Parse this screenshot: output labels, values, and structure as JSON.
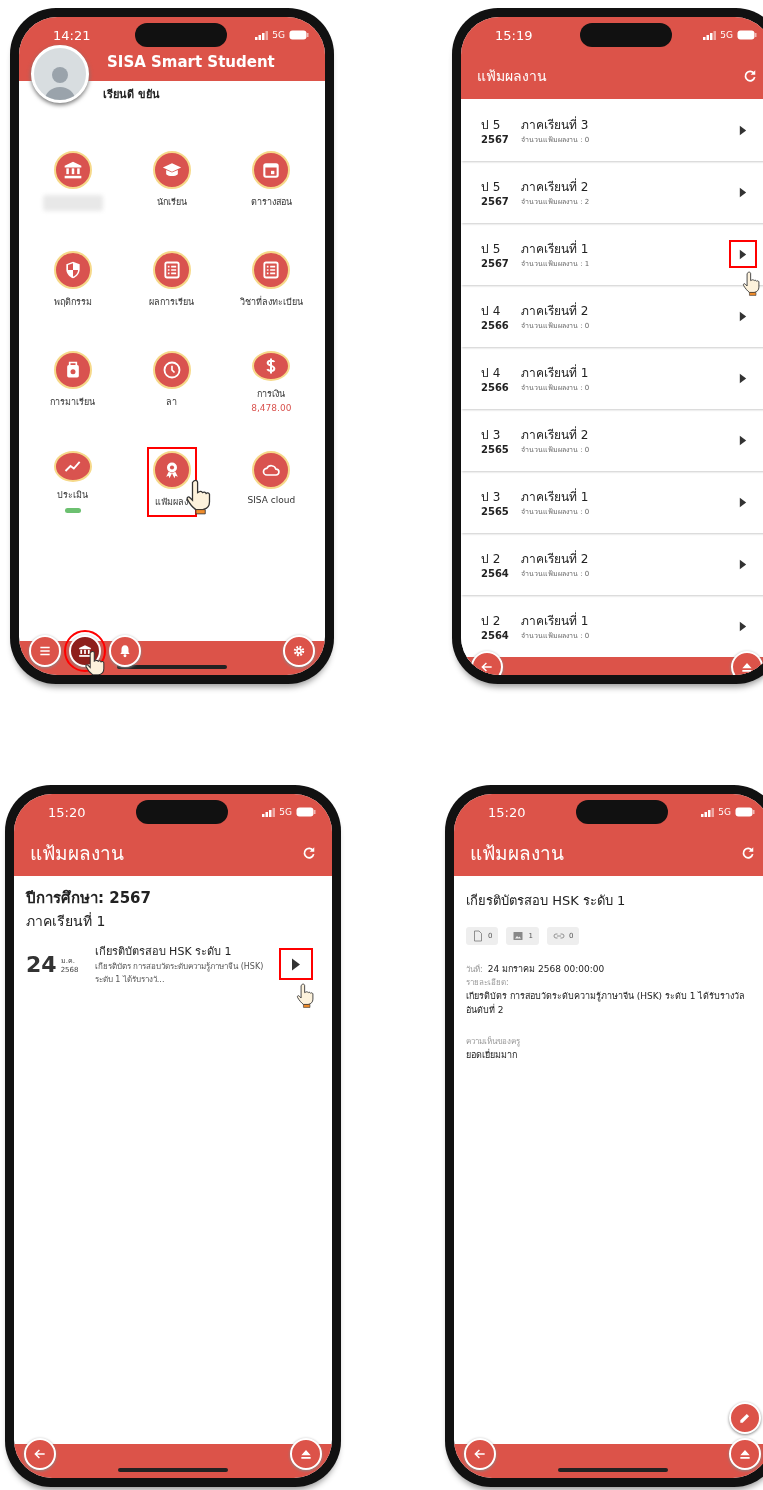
{
  "phones": [
    {
      "kind": "menu",
      "status": {
        "time": "14:21",
        "network": "5G"
      },
      "app_title": "SISA Smart Student",
      "user_name": "เรียนดี ขยัน",
      "tiles": [
        {
          "kind": "bank",
          "highlighted": false
        },
        {
          "kind": "graduation",
          "label": "นักเรียน",
          "highlighted": false
        },
        {
          "kind": "calendar",
          "label": "ตารางสอน",
          "highlighted": false
        },
        {
          "kind": "shield",
          "label": "พฤติกรรม",
          "highlighted": false
        },
        {
          "kind": "list",
          "label": "ผลการเรียน",
          "highlighted": false
        },
        {
          "kind": "list",
          "label": "วิชาที่ลงทะเบียน",
          "highlighted": false
        },
        {
          "kind": "bag",
          "label": "การมาเรียน",
          "highlighted": false
        },
        {
          "kind": "clock",
          "label": "ลา",
          "highlighted": false
        },
        {
          "kind": "dollar",
          "label": "การเงิน",
          "sub": "8,478.00",
          "highlighted": false
        },
        {
          "kind": "chart",
          "label": "ประเมิน",
          "pill": true,
          "highlighted": false
        },
        {
          "kind": "award",
          "label": "แฟ้มผลง",
          "highlighted": true
        },
        {
          "kind": "cloud",
          "label": "SISA cloud",
          "highlighted": false
        }
      ],
      "nav": [
        {
          "kind": "menu",
          "selected": false
        },
        {
          "kind": "bank",
          "selected": true
        },
        {
          "kind": "bell",
          "selected": false
        },
        {
          "kind": "gear",
          "selected": false
        }
      ]
    },
    {
      "kind": "semesters",
      "status": {
        "time": "15:19",
        "network": "5G"
      },
      "title": "แฟ้มผลงาน",
      "rows": [
        {
          "grade": "ป 5",
          "year": "2567",
          "term": "ภาคเรียนที่ 3",
          "count": "จำนวนแฟ้มผลงาน : 0",
          "highlighted": false
        },
        {
          "grade": "ป 5",
          "year": "2567",
          "term": "ภาคเรียนที่ 2",
          "count": "จำนวนแฟ้มผลงาน : 2",
          "highlighted": false
        },
        {
          "grade": "ป 5",
          "year": "2567",
          "term": "ภาคเรียนที่ 1",
          "count": "จำนวนแฟ้มผลงาน : 1",
          "highlighted": true
        },
        {
          "grade": "ป 4",
          "year": "2566",
          "term": "ภาคเรียนที่ 2",
          "count": "จำนวนแฟ้มผลงาน : 0",
          "highlighted": false
        },
        {
          "grade": "ป 4",
          "year": "2566",
          "term": "ภาคเรียนที่ 1",
          "count": "จำนวนแฟ้มผลงาน : 0",
          "highlighted": false
        },
        {
          "grade": "ป 3",
          "year": "2565",
          "term": "ภาคเรียนที่ 2",
          "count": "จำนวนแฟ้มผลงาน : 0",
          "highlighted": false
        },
        {
          "grade": "ป 3",
          "year": "2565",
          "term": "ภาคเรียนที่ 1",
          "count": "จำนวนแฟ้มผลงาน : 0",
          "highlighted": false
        },
        {
          "grade": "ป 2",
          "year": "2564",
          "term": "ภาคเรียนที่ 2",
          "count": "จำนวนแฟ้มผลงาน : 0",
          "highlighted": false
        },
        {
          "grade": "ป 2",
          "year": "2564",
          "term": "ภาคเรียนที่ 1",
          "count": "จำนวนแฟ้มผลงาน : 0",
          "highlighted": false
        }
      ]
    },
    {
      "kind": "portfolio",
      "status": {
        "time": "15:20",
        "network": "5G"
      },
      "title": "แฟ้มผลงาน",
      "year_heading": "ปีการศึกษา: 2567",
      "term": "ภาคเรียนที่ 1",
      "items": [
        {
          "day": "24",
          "month": "ม.ค.",
          "year": "2568",
          "title": "เกียรติบัตรสอบ HSK ระดับ 1",
          "summary": "เกียรติบัตร การสอบวัดระดับความรู้ภาษาจีน (HSK) ระดับ 1 ได้รับรางวั...",
          "highlighted": true
        }
      ]
    },
    {
      "kind": "detail",
      "status": {
        "time": "15:20",
        "network": "5G"
      },
      "title": "แฟ้มผลงาน",
      "item_title": "เกียรติบัตรสอบ HSK ระดับ 1",
      "counters": [
        {
          "kind": "file",
          "count": "0"
        },
        {
          "kind": "image",
          "count": "1"
        },
        {
          "kind": "link",
          "count": "0"
        }
      ],
      "date_label": "วันที่:",
      "date": "24 มกราคม 2568 00:00:00",
      "detail_label": "รายละเอียด:",
      "detail": "เกียรติบัตร การสอบวัดระดับความรู้ภาษาจีน (HSK) ระดับ 1 ได้รับรางวัล อันดับที่ 2",
      "comment_label": "ความเห็นของครู",
      "comment": "ยอดเยี่ยมมาก"
    }
  ]
}
